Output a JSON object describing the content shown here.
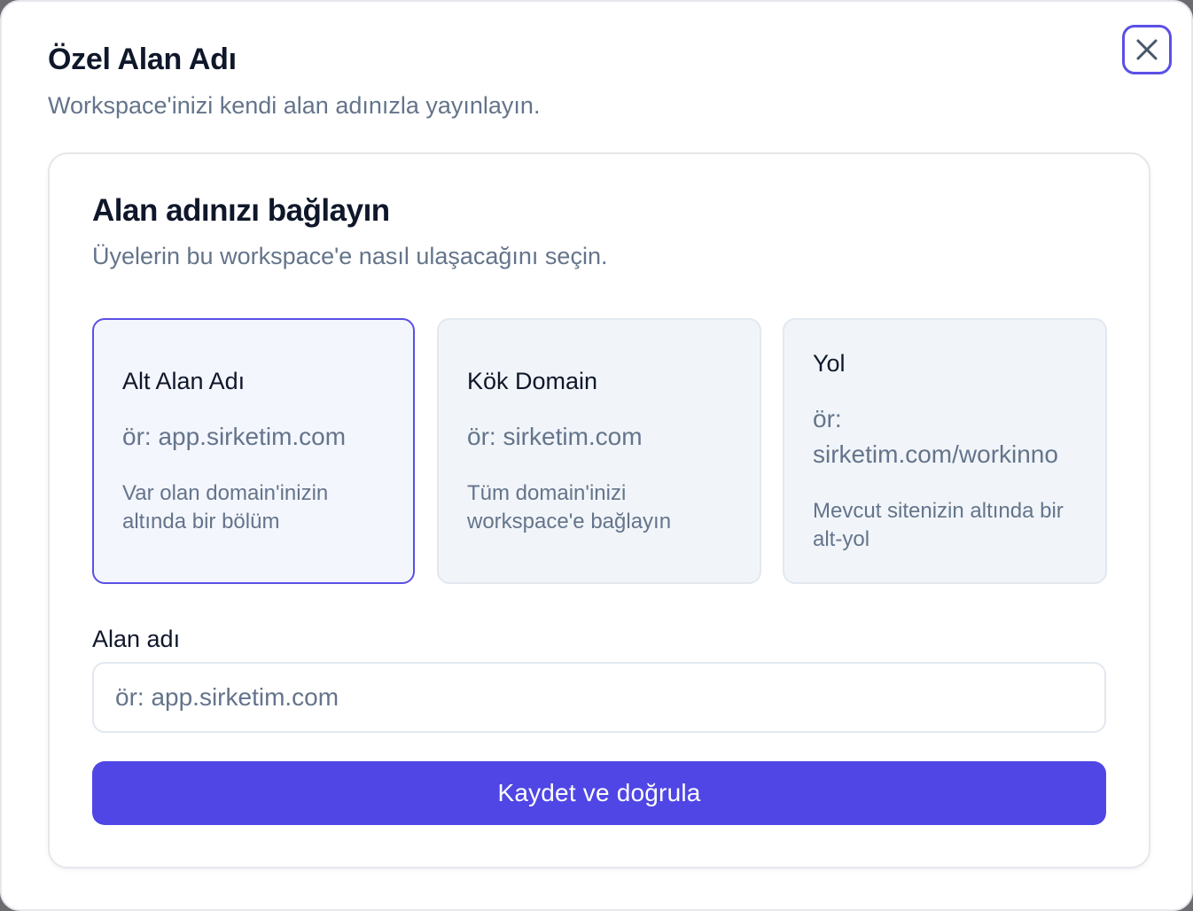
{
  "modal": {
    "title": "Özel Alan Adı",
    "subtitle": "Workspace'inizi kendi alan adınızla yayınlayın.",
    "close_icon": "close-icon"
  },
  "card": {
    "title": "Alan adınızı bağlayın",
    "subtitle": "Üyelerin bu workspace'e nasıl ulaşacağını seçin."
  },
  "options": [
    {
      "label": "Alt Alan Adı",
      "example": "ör: app.sirketim.com",
      "description": "Var olan domain'inizin altında bir bölüm",
      "selected": true
    },
    {
      "label": "Kök Domain",
      "example": "ör: sirketim.com",
      "description": "Tüm domain'inizi workspace'e bağlayın",
      "selected": false
    },
    {
      "label": "Yol",
      "example": "ör: sirketim.com/workinno",
      "description": "Mevcut sitenizin altında bir alt-yol",
      "selected": false
    }
  ],
  "domain_field": {
    "label": "Alan adı",
    "value": "",
    "placeholder": "ör: app.sirketim.com"
  },
  "save_button": {
    "label": "Kaydet ve doğrula"
  },
  "colors": {
    "accent": "#4f46e5",
    "selected_border": "#5b50e6",
    "title_text": "#0f172a",
    "muted_text": "#64748b"
  }
}
